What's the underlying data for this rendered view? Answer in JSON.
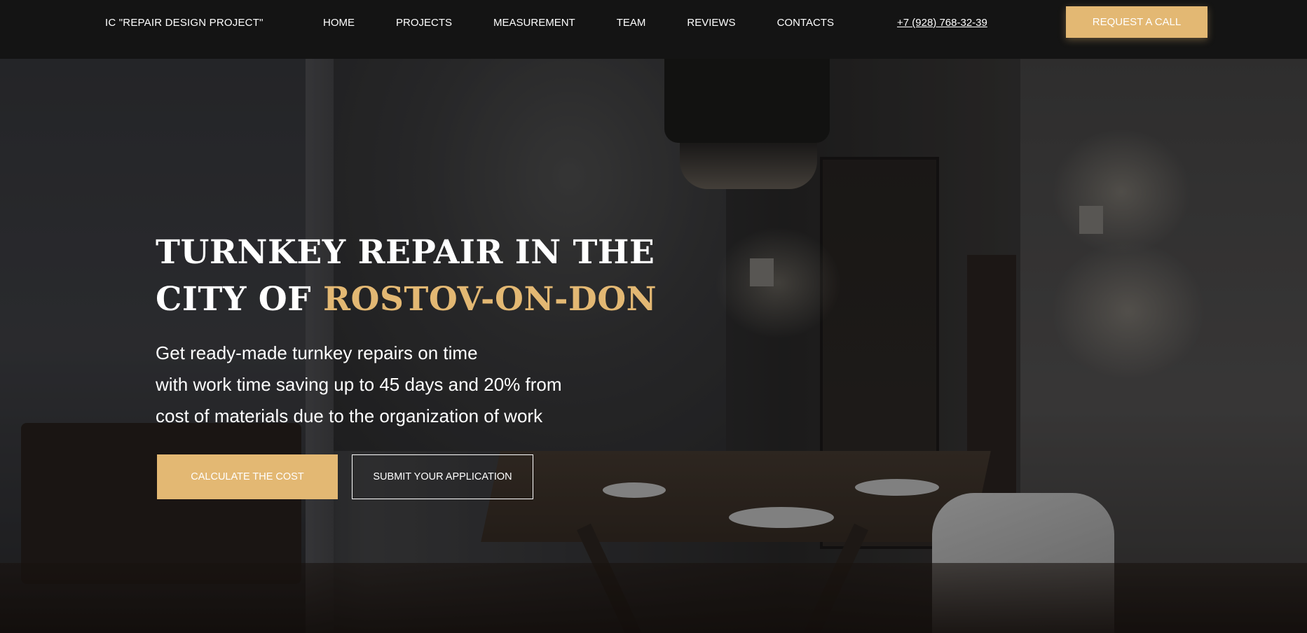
{
  "header": {
    "logo": "IC \"REPAIR DESIGN PROJECT\"",
    "nav": [
      "HOME",
      "PROJECTS",
      "MEASUREMENT",
      "TEAM",
      "REVIEWS",
      "CONTACTS"
    ],
    "phone": "+7 (928) 768-32-39",
    "cta": "REQUEST A CALL"
  },
  "hero": {
    "title_line1": "TURNKEY REPAIR IN THE",
    "title_line2_prefix": "CITY OF ",
    "title_line2_accent": "ROSTOV-ON-DON",
    "subtitle": [
      "Get ready-made turnkey repairs on time",
      "with work time saving up to 45 days and 20% from",
      "cost of materials due to the organization of work"
    ],
    "primary_button": "CALCULATE THE COST",
    "secondary_button": "SUBMIT YOUR APPLICATION"
  },
  "colors": {
    "accent": "#e3b873",
    "header_bg": "#141414",
    "text": "#ffffff"
  }
}
